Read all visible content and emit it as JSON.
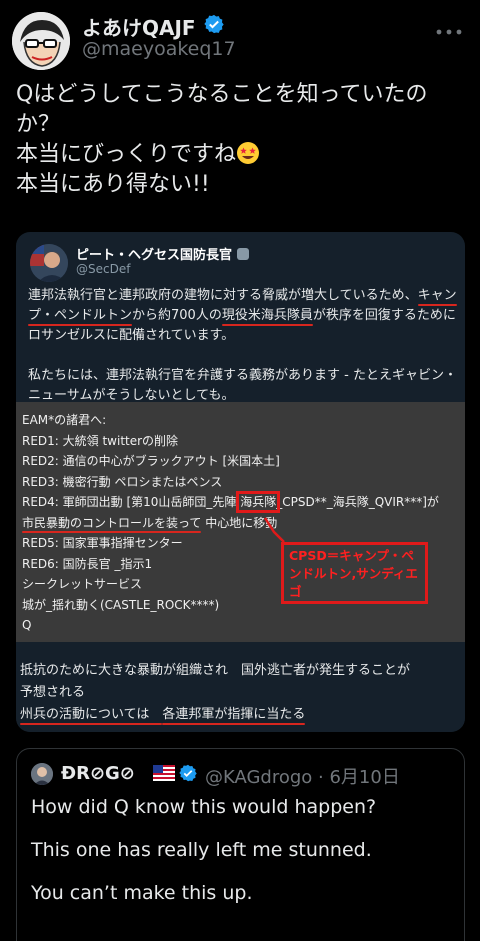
{
  "author": {
    "name": "よあけQAJF",
    "handle": "@maeyoakeq17",
    "icons": [
      "verified-badge-icon",
      "more-options-icon"
    ]
  },
  "tweet": {
    "lines": [
      "Qはどうしてこうなることを知っていたの",
      "か？",
      "本当にびっくりですね",
      "本当にあり得ない!!"
    ],
    "emoji": "star-struck-emoji"
  },
  "embedded": {
    "name": "ピート・ヘグセス国防長官",
    "handle": "@SecDef",
    "body": {
      "l1": "連邦法執行官と連邦政府の建物に対する脅威が増大しているため、",
      "l1b": "キャン",
      "l2a": "プ・ペンドルトン",
      "l2b": "から約700人の",
      "l2c": "現役米海兵隊員",
      "l2d": "が秩序を回復するために",
      "l3": "ロサンゼルスに配備されています。",
      "l4": "私たちには、連邦法執行官を弁護する義務があります - たとえギャビン・",
      "l5": "ニューサムがそうしないとしても。"
    },
    "eam": {
      "l0": "EAM*の諸君へ:",
      "l1": "RED1: 大統領 twitterの削除",
      "l2": "RED2: 通信の中心がブラックアウト [米国本土]",
      "l3": "RED3: 機密行動 ペロシまたはペンス",
      "l4a": "RED4: 軍師団出動 [第10山岳師団_先陣 ",
      "l4b": "海兵隊",
      "l4c": "_CPSD**_海兵隊_QVIR***]が",
      "l5a": "市民暴動のコントロールを装って",
      "l5b": " 中心地に移動",
      "l6": "RED5: 国家軍事指揮センター",
      "l7": "RED6: 国防長官 _指示1",
      "l8": "シークレットサービス",
      "l9": "城が_揺れ動く(CASTLE_ROCK****)",
      "l10": "Q"
    },
    "cpsd_note": "CPSD＝キャンプ・ペンドルトン,サンディエゴ",
    "lower": {
      "l1": "抵抗のために大きな暴動が組織され　国外逃亡者が発生することが",
      "l2": "予想される",
      "l3a": "州兵の活動については　",
      "l3b": "各連邦軍が指揮に当たる"
    }
  },
  "quote": {
    "name": "ÐR⊘G⊘",
    "flag": "us-flag-emoji",
    "handle": "@KAGdrogo · 6月10日",
    "lines": [
      "How did Q know this would happen?",
      "",
      "This one has really left me stunned.",
      "",
      "You can’t make this up."
    ]
  },
  "colors": {
    "background": "#000000",
    "verified": "#1d9bf0",
    "annotation_red": "#e01a1a"
  }
}
